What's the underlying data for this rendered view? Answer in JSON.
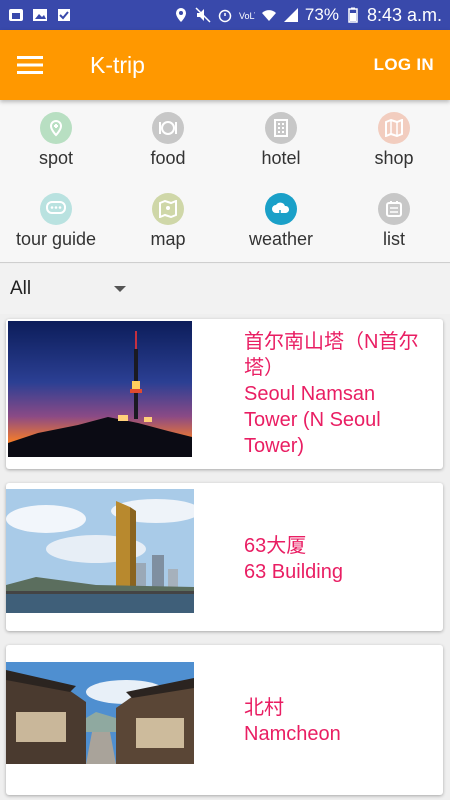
{
  "status_bar": {
    "battery": "73%",
    "time": "8:43 a.m."
  },
  "app_bar": {
    "title": "K-trip",
    "login_label": "LOG IN"
  },
  "categories": [
    {
      "label": "spot",
      "icon": "location-pin-icon",
      "color": "#b8dfc2"
    },
    {
      "label": "food",
      "icon": "plate-cutlery-icon",
      "color": "#c7c7c7"
    },
    {
      "label": "hotel",
      "icon": "building-icon",
      "color": "#c7c7c7"
    },
    {
      "label": "shop",
      "icon": "map-fold-icon",
      "color": "#f2cdbf"
    },
    {
      "label": "tour guide",
      "icon": "chat-bubble-icon",
      "color": "#b9e2e0"
    },
    {
      "label": "map",
      "icon": "map-pin-icon",
      "color": "#cfd7a8"
    },
    {
      "label": "weather",
      "icon": "cloud-icon",
      "color": "#1aa0c8"
    },
    {
      "label": "list",
      "icon": "list-box-icon",
      "color": "#c7c7c7"
    }
  ],
  "filter": {
    "selected": "All"
  },
  "cards": [
    {
      "title_cn": "首尔南山塔（N首尔塔）",
      "title_en": "Seoul Namsan Tower (N Seoul Tower)"
    },
    {
      "title_cn": "63大厦",
      "title_en": "63 Building"
    },
    {
      "title_cn": "北村",
      "title_en": "Namcheon"
    }
  ],
  "colors": {
    "status_bar": "#3949ab",
    "app_bar": "#ff9800",
    "accent_text": "#e91e63"
  }
}
